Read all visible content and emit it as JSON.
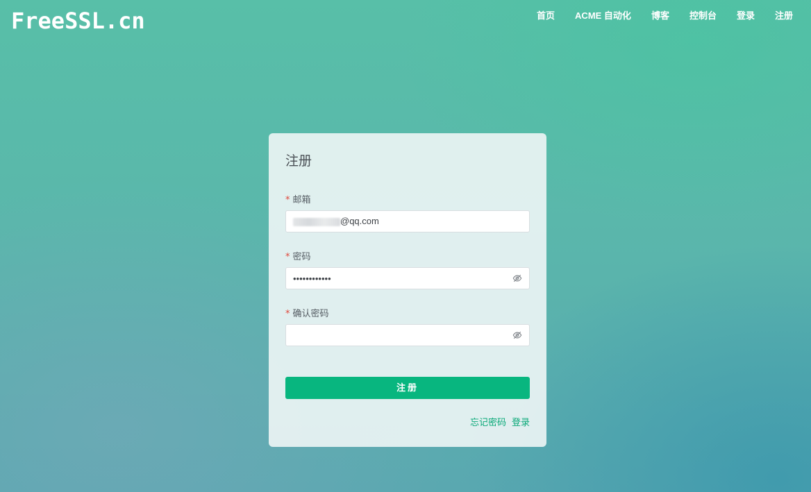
{
  "header": {
    "logo": "FreeSSL.cn",
    "nav": [
      "首页",
      "ACME 自动化",
      "博客",
      "控制台",
      "登录",
      "注册"
    ]
  },
  "form": {
    "title": "注册",
    "email": {
      "label": "邮箱",
      "required_mark": "*",
      "value_visible_suffix": "@qq.com"
    },
    "password": {
      "label": "密码",
      "required_mark": "*",
      "value_masked": "••••••••••••"
    },
    "confirm_password": {
      "label": "确认密码",
      "required_mark": "*",
      "value": ""
    },
    "submit_label": "注册",
    "links": {
      "forgot_password": "忘记密码",
      "login": "登录"
    }
  },
  "colors": {
    "accent": "#08b67f",
    "link": "#09a877",
    "required": "#e0473c"
  },
  "icons": {
    "password_toggle": "eye-off-icon"
  }
}
